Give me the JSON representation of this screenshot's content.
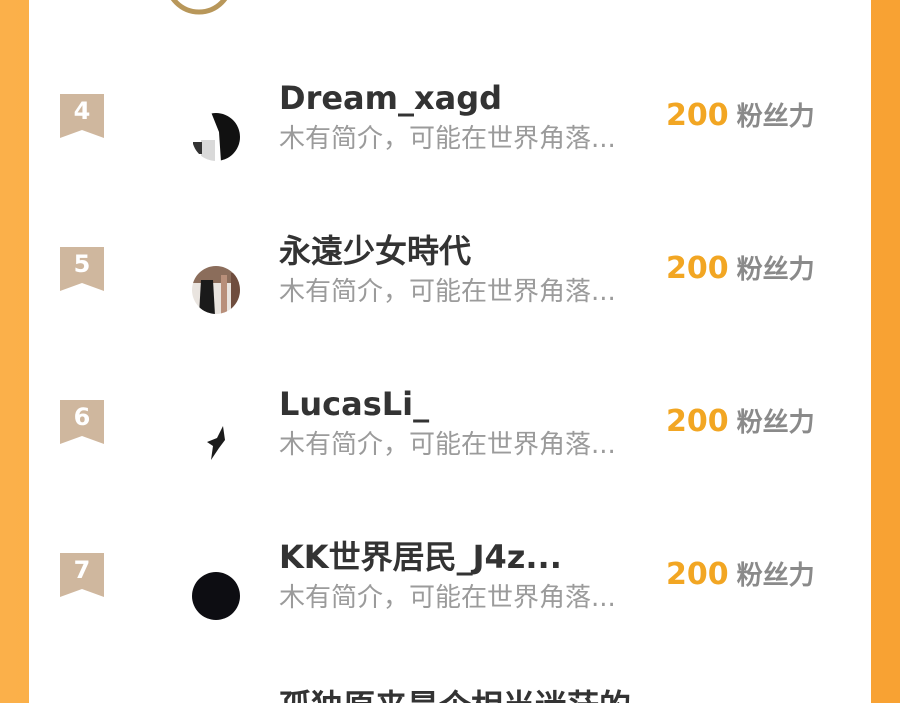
{
  "ranking": {
    "rows": [
      {
        "rank": "4",
        "name": "Dream_xagd",
        "desc": "木有简介，可能在世界角落...",
        "score": "200",
        "unit": "粉丝力"
      },
      {
        "rank": "5",
        "name": "永遠少女時代",
        "desc": "木有简介，可能在世界角落...",
        "score": "200",
        "unit": "粉丝力"
      },
      {
        "rank": "6",
        "name": "LucasLi_",
        "desc": "木有简介，可能在世界角落...",
        "score": "200",
        "unit": "粉丝力"
      },
      {
        "rank": "7",
        "name": "KK世界居民_J4z...",
        "desc": "木有简介，可能在世界角落...",
        "score": "200",
        "unit": "粉丝力"
      }
    ],
    "next_partial_name": "孤独原来是个相当迷茫的"
  },
  "colors": {
    "background_orange": "#f9a83a",
    "rank_badge": "#cfb79e",
    "score": "#f2a623",
    "name": "#333333",
    "desc": "#9b9b9b"
  }
}
